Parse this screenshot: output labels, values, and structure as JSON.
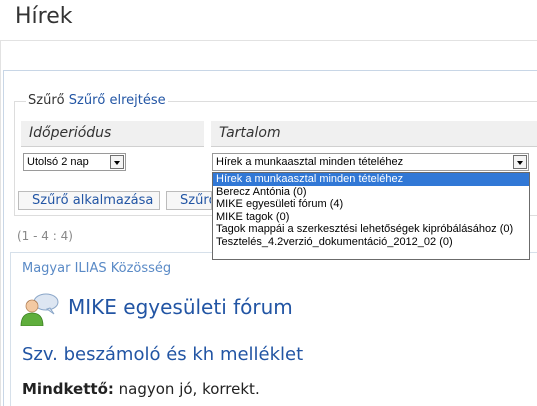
{
  "page": {
    "title": "Hírek"
  },
  "filter": {
    "label": "Szűrő",
    "hide_link": "Szűrő elrejtése",
    "period_header": "Időperiódus",
    "content_header": "Tartalom",
    "period_value": "Utolsó 2 nap",
    "content_value": "Hírek a munkaasztal minden tételéhez",
    "content_options": [
      "Hírek a munkaasztal minden tételéhez",
      "Berecz Antónia (0)",
      "MIKE egyesületi fórum (4)",
      "MIKE tagok (0)",
      "Tagok mappái a szerkesztési lehetőségek kipróbálásához (0)",
      "Tesztelés_4.2verzió_dokumentáció_2012_02 (0)"
    ],
    "apply_button": "Szűrő alkalmazása",
    "hide_button": "Szűrő elrejtése"
  },
  "list": {
    "range": "(1 - 4 : 4)",
    "community": "Magyar ILIAS Közösség",
    "forum_title": "MIKE egyesületi fórum",
    "post_title": "Szv. beszámoló és kh melléklet",
    "post_author": "Mindkettő:",
    "post_text": " nagyon jó, korrekt."
  },
  "colors": {
    "link": "#2255a4",
    "selection": "#3178d6",
    "header_bg": "#f0f0f0"
  },
  "icons": {
    "forum": "forum-users-icon",
    "select_arrow": "chevron-down-icon"
  }
}
